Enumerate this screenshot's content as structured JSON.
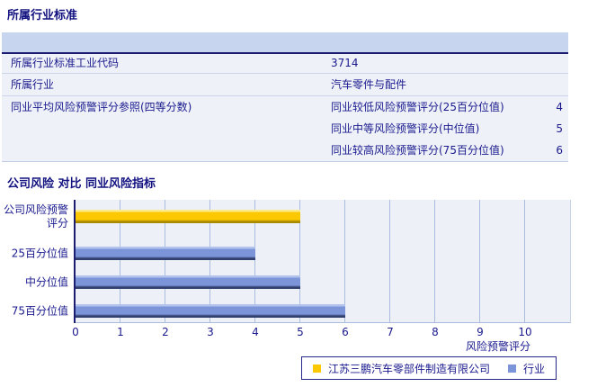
{
  "sections": {
    "industry": {
      "title": "所属行业标准"
    },
    "comparison": {
      "title": "公司风险 对比 同业风险指标"
    }
  },
  "table": {
    "rows": [
      {
        "label": "所属行业标准工业代码",
        "value": "3714"
      },
      {
        "label": "所属行业",
        "value": "汽车零件与配件"
      },
      {
        "label": "同业平均风险预警评分参照(四等分数)",
        "subrows": [
          {
            "label": "同业较低风险预警评分(25百分位值)",
            "value": "4"
          },
          {
            "label": "同业中等风险预警评分(中位值)",
            "value": "5"
          },
          {
            "label": "同业较高风险预警评分(75百分位值)",
            "value": "6"
          }
        ]
      }
    ]
  },
  "chart_data": {
    "type": "bar",
    "orientation": "horizontal",
    "categories": [
      "公司风险预警评分",
      "25百分位值",
      "中分位值",
      "75百分位值"
    ],
    "series": [
      {
        "name": "江苏三鹏汽车零部件制造有限公司",
        "values": [
          5,
          null,
          null,
          null
        ],
        "color": "#fcc800",
        "color_top": "#fdeb8a",
        "color_bottom": "#a88a00"
      },
      {
        "name": "行业",
        "values": [
          null,
          4,
          5,
          6
        ],
        "color": "#7b95d8",
        "color_top": "#b3c3eb",
        "color_bottom": "#32406f"
      }
    ],
    "xlabel": "风险预警评分",
    "xlim": [
      0,
      10
    ],
    "ticks": [
      0,
      1,
      2,
      3,
      4,
      5,
      6,
      7,
      8,
      9,
      10
    ],
    "grid": true,
    "legend_position": "bottom"
  },
  "colors": {
    "text_navy": "#1a1a8e",
    "title_navy": "#121280",
    "table_header_band": "#c8d5ee",
    "table_row_bg": "#eef1f8",
    "plot_bg": "#edf0f7",
    "gridline": "#aabdde",
    "axis": "#1c1c72",
    "company_bar": "#fcc800",
    "industry_bar": "#7b95d8"
  }
}
